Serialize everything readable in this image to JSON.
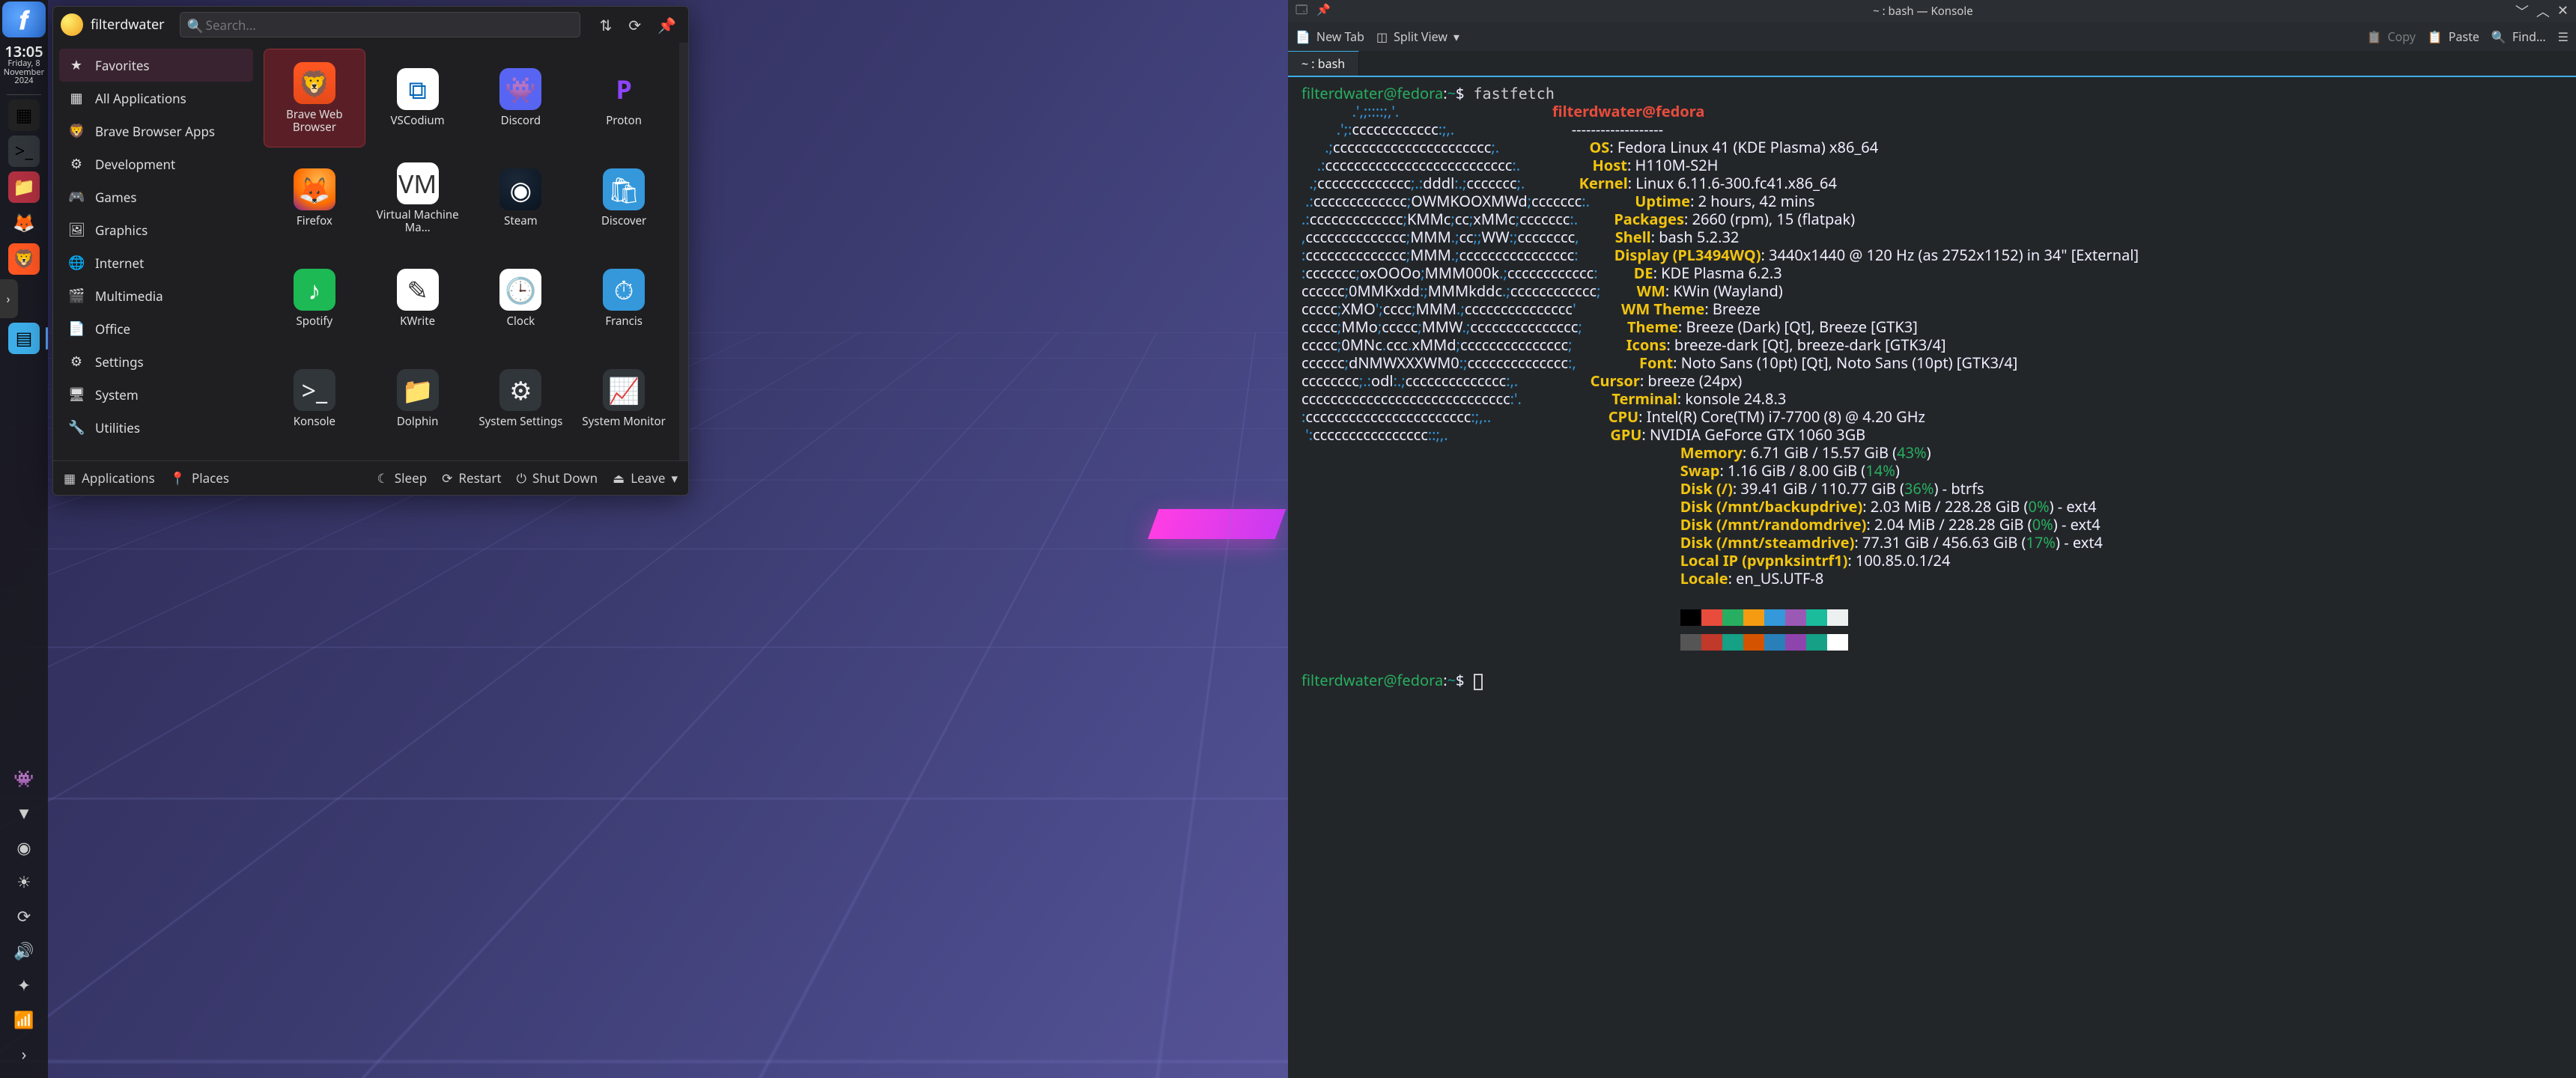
{
  "panel": {
    "clock_time": "13:05",
    "clock_day": "Friday, 8",
    "clock_month": "November",
    "clock_year": "2024",
    "tasks": [
      {
        "name": "desktop-pager",
        "glyph": "▦",
        "bg": "#222"
      },
      {
        "name": "konsole-task",
        "glyph": ">_",
        "bg": "#31363b"
      },
      {
        "name": "dolphin-task",
        "glyph": "📁",
        "bg": "#b03040"
      },
      {
        "name": "firefox-task",
        "glyph": "🦊",
        "bg": "transparent"
      },
      {
        "name": "brave-task",
        "glyph": "🦁",
        "bg": "#ff5722"
      }
    ],
    "arrow": "›",
    "active_glyph": "▤",
    "tray": [
      {
        "name": "discord-tray",
        "glyph": "👾"
      },
      {
        "name": "proton-tray",
        "glyph": "▼"
      },
      {
        "name": "steam-tray",
        "glyph": "◉"
      },
      {
        "name": "brightness-tray",
        "glyph": "☀"
      },
      {
        "name": "updates-tray",
        "glyph": "⟳"
      },
      {
        "name": "volume-tray",
        "glyph": "🔊"
      },
      {
        "name": "night-tray",
        "glyph": "✦"
      },
      {
        "name": "network-tray",
        "glyph": "📶"
      },
      {
        "name": "expand-tray",
        "glyph": "›"
      }
    ]
  },
  "launcher": {
    "username": "filterdwater",
    "search_placeholder": "Search…",
    "categories": [
      {
        "icon": "★",
        "label": "Favorites",
        "sel": true
      },
      {
        "icon": "▦",
        "label": "All Applications"
      },
      {
        "icon": "🦁",
        "label": "Brave Browser Apps"
      },
      {
        "icon": "⚙",
        "label": "Development"
      },
      {
        "icon": "🎮",
        "label": "Games"
      },
      {
        "icon": "🖼",
        "label": "Graphics"
      },
      {
        "icon": "🌐",
        "label": "Internet"
      },
      {
        "icon": "🎬",
        "label": "Multimedia"
      },
      {
        "icon": "📄",
        "label": "Office"
      },
      {
        "icon": "⚙",
        "label": "Settings"
      },
      {
        "icon": "🖥",
        "label": "System"
      },
      {
        "icon": "🔧",
        "label": "Utilities"
      }
    ],
    "apps": [
      {
        "cls": "ic-brave",
        "glyph": "🦁",
        "label": "Brave Web Browser",
        "sel": true
      },
      {
        "cls": "ic-vsc",
        "glyph": "⧉",
        "label": "VSCodium"
      },
      {
        "cls": "ic-discord",
        "glyph": "👾",
        "label": "Discord"
      },
      {
        "cls": "ic-proton",
        "glyph": "P",
        "label": "Proton"
      },
      {
        "cls": "ic-firefox",
        "glyph": "🦊",
        "label": "Firefox"
      },
      {
        "cls": "ic-vmm",
        "glyph": "VM",
        "label": "Virtual Machine Ma…"
      },
      {
        "cls": "ic-steam",
        "glyph": "◉",
        "label": "Steam"
      },
      {
        "cls": "ic-discover",
        "glyph": "🛍",
        "label": "Discover"
      },
      {
        "cls": "ic-spotify",
        "glyph": "♪",
        "label": "Spotify"
      },
      {
        "cls": "ic-kwrite",
        "glyph": "✎",
        "label": "KWrite"
      },
      {
        "cls": "ic-clock",
        "glyph": "🕒",
        "label": "Clock"
      },
      {
        "cls": "ic-francis",
        "glyph": "⏱",
        "label": "Francis"
      },
      {
        "cls": "ic-konsole",
        "glyph": ">_",
        "label": "Konsole"
      },
      {
        "cls": "ic-dolphin",
        "glyph": "📁",
        "label": "Dolphin"
      },
      {
        "cls": "ic-syssettings",
        "glyph": "⚙",
        "label": "System Settings"
      },
      {
        "cls": "ic-sysmonitor",
        "glyph": "📈",
        "label": "System Monitor"
      }
    ],
    "footer": {
      "applications": "Applications",
      "places": "Places",
      "sleep": "Sleep",
      "restart": "Restart",
      "shutdown": "Shut Down",
      "leave": "Leave"
    }
  },
  "konsole": {
    "title": "~ : bash — Konsole",
    "toolbar": {
      "new_tab": "New Tab",
      "split": "Split View",
      "copy": "Copy",
      "paste": "Paste",
      "find": "Find…"
    },
    "tab_label": "~ : bash",
    "prompt_user": "filterdwater@fedora",
    "prompt_path": "~",
    "prompt_sep": ":",
    "prompt_dollar": "$",
    "command": "fastfetch",
    "header_user": "filterdwater@fedora",
    "header_rule": "-------------------",
    "info": [
      {
        "k": "OS",
        "v": "Fedora Linux 41 (KDE Plasma) x86_64"
      },
      {
        "k": "Host",
        "v": "H110M-S2H"
      },
      {
        "k": "Kernel",
        "v": "Linux 6.11.6-300.fc41.x86_64"
      },
      {
        "k": "Uptime",
        "v": "2 hours, 42 mins"
      },
      {
        "k": "Packages",
        "v": "2660 (rpm), 15 (flatpak)"
      },
      {
        "k": "Shell",
        "v": "bash 5.2.32"
      },
      {
        "k": "Display (PL3494WQ)",
        "v": "3440x1440 @ 120 Hz (as 2752x1152) in 34\" [External]"
      },
      {
        "k": "DE",
        "v": "KDE Plasma 6.2.3"
      },
      {
        "k": "WM",
        "v": "KWin (Wayland)"
      },
      {
        "k": "WM Theme",
        "v": "Breeze"
      },
      {
        "k": "Theme",
        "v": "Breeze (Dark) [Qt], Breeze [GTK3]"
      },
      {
        "k": "Icons",
        "v": "breeze-dark [Qt], breeze-dark [GTK3/4]"
      },
      {
        "k": "Font",
        "v": "Noto Sans (10pt) [Qt], Noto Sans (10pt) [GTK3/4]"
      },
      {
        "k": "Cursor",
        "v": "breeze (24px)"
      },
      {
        "k": "Terminal",
        "v": "konsole 24.8.3"
      },
      {
        "k": "CPU",
        "v": "Intel(R) Core(TM) i7-7700 (8) @ 4.20 GHz"
      },
      {
        "k": "GPU",
        "v": "NVIDIA GeForce GTX 1060 3GB"
      }
    ],
    "mem": {
      "k": "Memory",
      "pre": "6.71 GiB / 15.57 GiB (",
      "pct": "43%",
      "post": ")"
    },
    "swap": {
      "k": "Swap",
      "pre": "1.16 GiB / 8.00 GiB (",
      "pct": "14%",
      "post": ")"
    },
    "disks": [
      {
        "k": "Disk (/)",
        "pre": "39.41 GiB / 110.77 GiB (",
        "pct": "36%",
        "post": ") - btrfs",
        "cls": "t-green"
      },
      {
        "k": "Disk (/mnt/backupdrive)",
        "pre": "2.03 MiB / 228.28 GiB (",
        "pct": "0%",
        "post": ") - ext4",
        "cls": "t-green"
      },
      {
        "k": "Disk (/mnt/randomdrive)",
        "pre": "2.04 MiB / 228.28 GiB (",
        "pct": "0%",
        "post": ") - ext4",
        "cls": "t-green"
      },
      {
        "k": "Disk (/mnt/steamdrive)",
        "pre": "77.31 GiB / 456.63 GiB (",
        "pct": "17%",
        "post": ") - ext4",
        "cls": "t-green"
      }
    ],
    "tail": [
      {
        "k": "Local IP (pvpnksintrf1)",
        "v": "100.85.0.1/24"
      },
      {
        "k": "Locale",
        "v": "en_US.UTF-8"
      }
    ],
    "swatches_top": [
      "#000",
      "#e74c3c",
      "#27ae60",
      "#f39c12",
      "#3498db",
      "#9b59b6",
      "#1abc9c",
      "#ecf0f1"
    ],
    "swatches_bot": [
      "#555",
      "#c0392b",
      "#16a085",
      "#d35400",
      "#2980b9",
      "#8e44ad",
      "#16a085",
      "#fff"
    ],
    "logo": [
      "             .',;::::;,'.",
      "         .';:cccccccccccc:;,.",
      "      .;cccccccccccccccccccccc;.",
      "    .:cccccccccccccccccccccccccc:.",
      "  .;ccccccccccccc;.:dddl:.;ccccccc;.",
      " .:ccccccccccccc;OWMKOOXMWd;ccccccc:.",
      ".:ccccccccccccc;KMMc;cc;xMMc;ccccccc:.",
      ",cccccccccccccc;MMM.;cc;;WW:;cccccccc,",
      ":cccccccccccccc;MMM.;cccccccccccccccc:",
      ":ccccccc;oxOOOo;MMM000k.;cccccccccccc:",
      "cccccc;0MMKxdd:;MMMkddc.;cccccccccccc;",
      "ccccc;XMO';cccc;MMM.;ccccccccccccccc'",
      "ccccc;MMo;ccccc;MMW.;ccccccccccccccc;",
      "ccccc;0MNc.ccc.xMMd;ccccccccccccccc;",
      "cccccc;dNMWXXXWM0:;cccccccccccccc:,",
      "cccccccc;.:odl:.;cccccccccccccc:,.",
      "ccccccccccccccccccccccccccccc:'.",
      ":ccccccccccccccccccccccc:;,..",
      " ':cccccccccccccccc::;,."
    ]
  }
}
